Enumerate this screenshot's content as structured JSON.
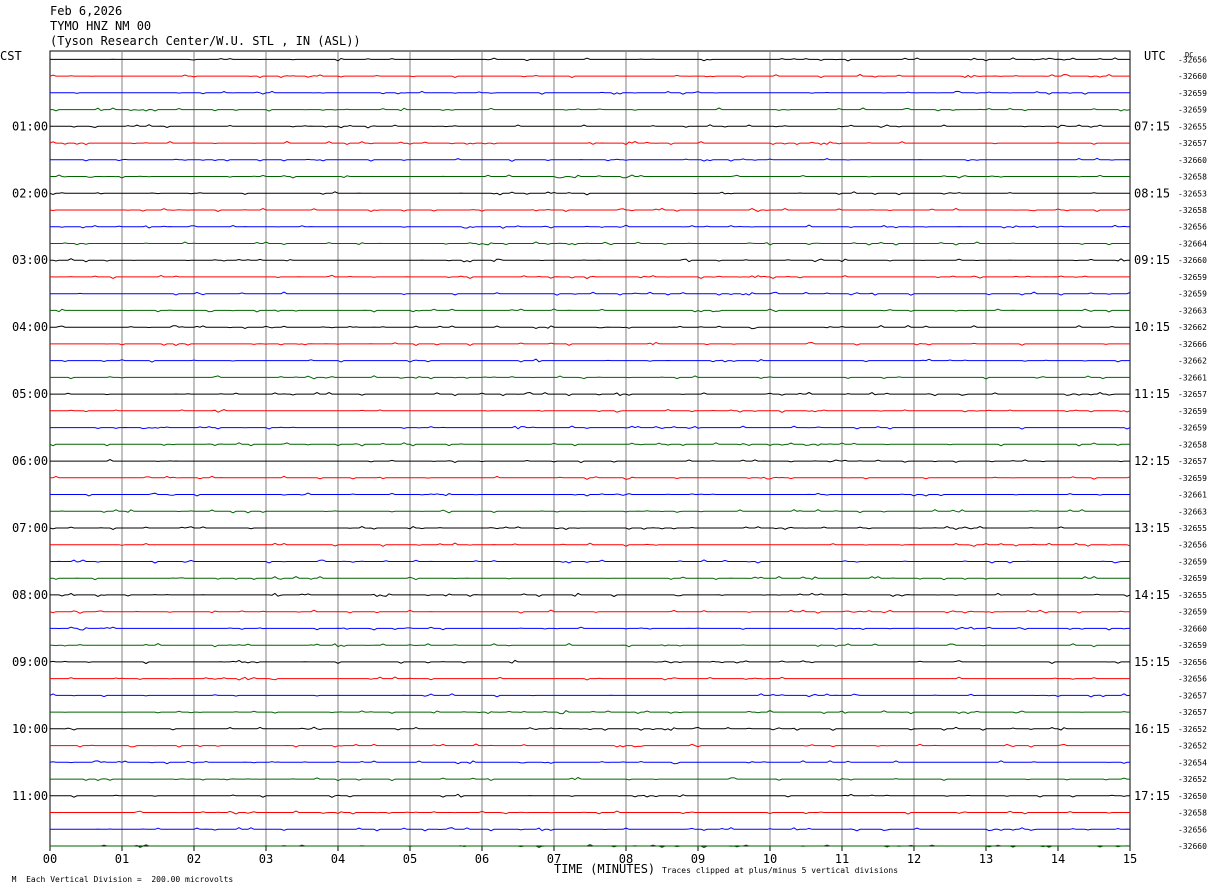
{
  "header": {
    "date": "Feb 6,2026",
    "station": "TYMO HNZ NM 00",
    "location": "(Tyson Research Center/W.U. STL , IN (ASL))"
  },
  "chart_data": {
    "type": "line",
    "subtype": "helicorder",
    "left_zone_label": "CST",
    "right_zone_label": "UTC",
    "dc_label": "DC",
    "xlabel": "TIME (MINUTES)",
    "x_ticks": [
      "00",
      "01",
      "02",
      "03",
      "04",
      "05",
      "06",
      "07",
      "08",
      "09",
      "10",
      "11",
      "12",
      "13",
      "14",
      "15"
    ],
    "xlim": [
      0,
      15
    ],
    "trace_colors": [
      "#000000",
      "#ff0000",
      "#0000ff",
      "#006400"
    ],
    "grid_color": "#808080",
    "hour_labels_cst": [
      "01:00",
      "02:00",
      "03:00",
      "04:00",
      "05:00",
      "06:00",
      "07:00",
      "08:00",
      "09:00",
      "10:00",
      "11:00"
    ],
    "hour_labels_utc": [
      "07:15",
      "08:15",
      "09:15",
      "10:15",
      "11:15",
      "12:15",
      "13:15",
      "14:15",
      "15:15",
      "16:15",
      "17:15"
    ],
    "dc_offsets": [
      "-32656",
      "-32660",
      "-32659",
      "-32659",
      "-32655",
      "-32657",
      "-32660",
      "-32658",
      "-32653",
      "-32658",
      "-32656",
      "-32664",
      "-32660",
      "-32659",
      "-32659",
      "-32663",
      "-32662",
      "-32666",
      "-32662",
      "-32661",
      "-32657",
      "-32659",
      "-32659",
      "-32658",
      "-32657",
      "-32659",
      "-32661",
      "-32663",
      "-32655",
      "-32656",
      "-32659",
      "-32659",
      "-32655",
      "-32659",
      "-32660",
      "-32659",
      "-32656",
      "-32656",
      "-32657",
      "-32657",
      "-32652",
      "-32652",
      "-32654",
      "-32652",
      "-32650",
      "-32658",
      "-32656",
      "-32660"
    ]
  },
  "footer": {
    "left": "Each Vertical Division =  200.00 microvolts",
    "right": "Traces clipped at plus/minus 5 vertical divisions",
    "marker": "M"
  }
}
